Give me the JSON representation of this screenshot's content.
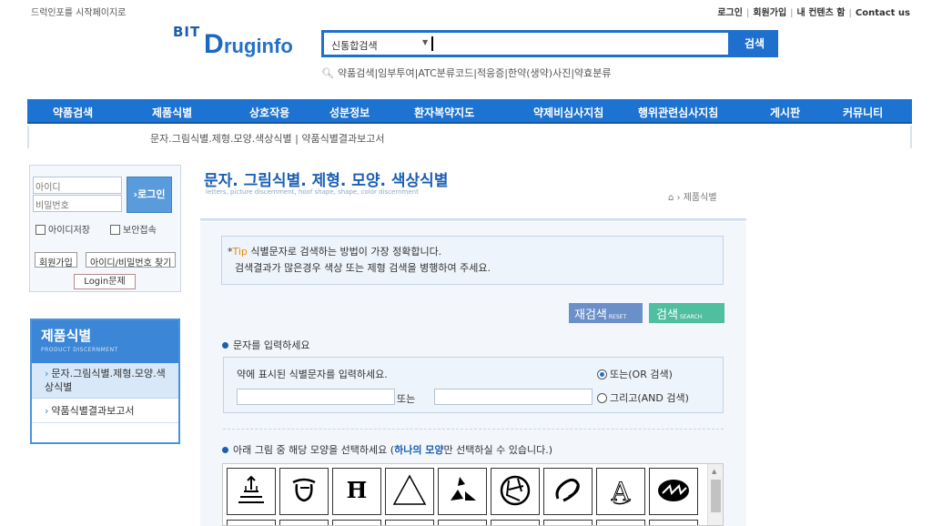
{
  "util": {
    "start_page": "드럭인포를 시작페이지로",
    "login": "로그인",
    "join": "회원가입",
    "my_contents": "내 컨텐츠 함",
    "contact": "Contact us"
  },
  "logo": {
    "bit": "BIT",
    "d": "D",
    "rest": "ruginfo"
  },
  "search": {
    "category": "신통합검색",
    "button": "검색",
    "sublinks": "약품검색|임부투여|ATC분류코드|적응증|한약(생약)사진|약효분류"
  },
  "gnb": [
    "약품검색",
    "제품식별",
    "상호작용",
    "성분정보",
    "환자복약지도",
    "약제비심사지침",
    "행위관련심사지침",
    "게시판",
    "커뮤니티"
  ],
  "lnb": {
    "text": "문자.그림식별.제형.모양.색상식별  |  약품식별결과보고서"
  },
  "login_box": {
    "id_placeholder": "아이디",
    "pw_placeholder": "비밀번호",
    "login_button": "›로그인",
    "save_id": "아이디저장",
    "secure": "보안접속",
    "join_button": "회원가입",
    "find_button": "아이디/비밀번호 찾기",
    "issue_button": "Login문제"
  },
  "side_menu": {
    "title": "제품식별",
    "subtitle": "PRODUCT DISCERNMENT",
    "items": [
      "문자.그림식별.제형.모양.색상식별",
      "약품식별결과보고서"
    ]
  },
  "page": {
    "title": "문자. 그림식별. 제형. 모양. 색상식별",
    "subtitle": "letters, picture discernment, hoof shape, shape, color discernment",
    "breadcrumb": "제품식별"
  },
  "tip": {
    "label": "Tip",
    "line1": "식별문자로 검색하는 방법이 가장 정확합니다.",
    "line2": "검색결과가 많은경우 색상 또는 제형 검색을 병행하여 주세요."
  },
  "buttons": {
    "reset": "재검색",
    "reset_en": "RESET",
    "search": "검색",
    "search_en": "SEARCH"
  },
  "text_section": {
    "title": "문자를 입력하세요",
    "label": "약에 표시된 식별문자를 입력하세요.",
    "or_text": "또는",
    "radio_or": "또는(OR 검색)",
    "radio_and": "그리고(AND 검색)"
  },
  "shape_section": {
    "title_pre": "아래 그림 중 해당 모양을 선택하세요 (",
    "title_em": "하나의 모양",
    "title_post": "만 선택하실 수 있습니다.)"
  },
  "colors": {
    "brand_blue": "#1d73d1",
    "accent_orange": "#e68a00",
    "reset_btn": "#6b8fc9",
    "search_btn": "#4fbfa0"
  }
}
